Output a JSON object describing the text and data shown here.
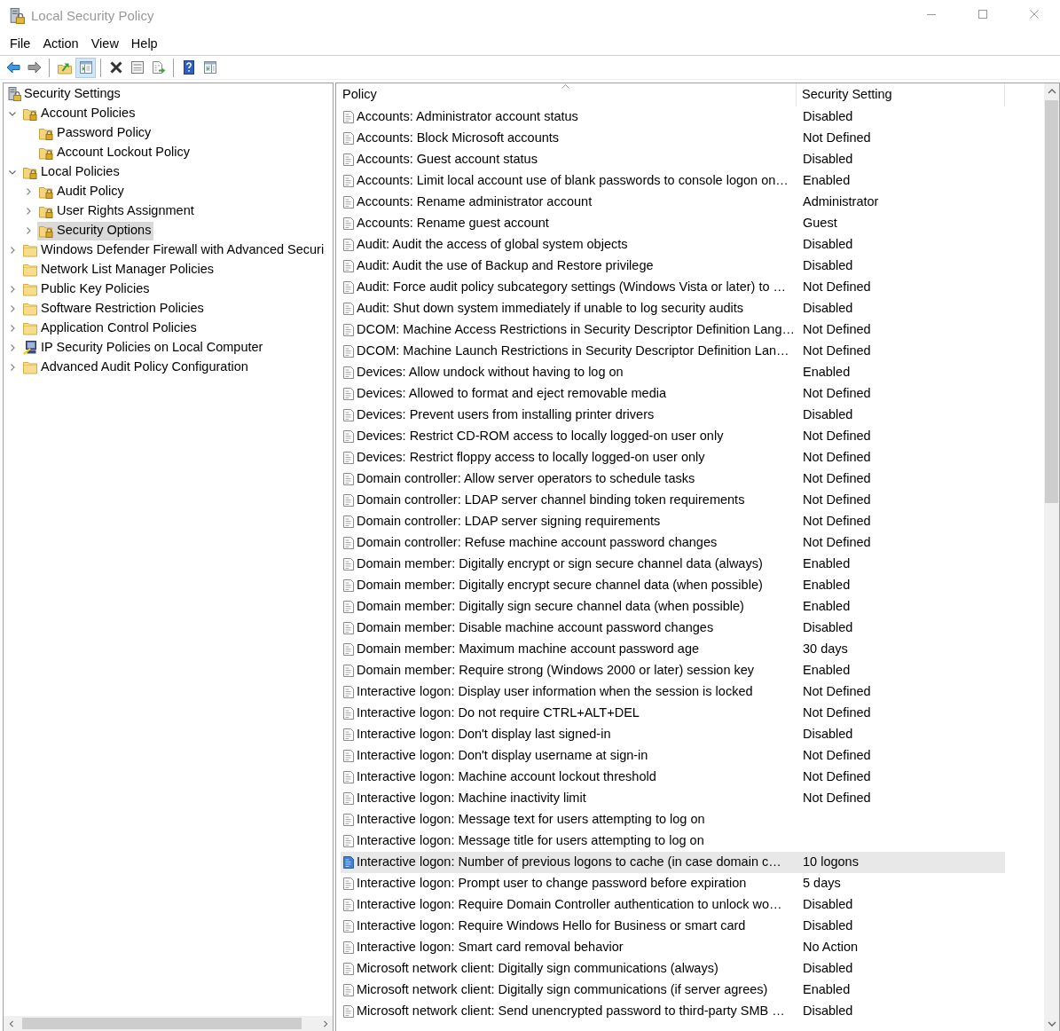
{
  "window": {
    "title": "Local Security Policy"
  },
  "menu_bar": [
    "File",
    "Action",
    "View",
    "Help"
  ],
  "toolbar": [
    {
      "kind": "back",
      "disabled": false,
      "pressed": false
    },
    {
      "kind": "forward",
      "disabled": true,
      "pressed": false
    },
    {
      "kind": "separator"
    },
    {
      "kind": "up",
      "disabled": false,
      "pressed": false
    },
    {
      "kind": "tree",
      "disabled": false,
      "pressed": true
    },
    {
      "kind": "separator"
    },
    {
      "kind": "delete",
      "disabled": false,
      "pressed": false
    },
    {
      "kind": "properties",
      "disabled": false,
      "pressed": false
    },
    {
      "kind": "export",
      "disabled": false,
      "pressed": false
    },
    {
      "kind": "separator"
    },
    {
      "kind": "help",
      "disabled": false,
      "pressed": false
    },
    {
      "kind": "action_pane",
      "disabled": false,
      "pressed": false
    }
  ],
  "tree": [
    {
      "label": "Security Settings",
      "kind": "root",
      "selected": false,
      "children": [
        {
          "label": "Account Policies",
          "kind": "secured",
          "expanded": true,
          "selected": false,
          "children": [
            {
              "label": "Password Policy",
              "kind": "secured",
              "selected": false
            },
            {
              "label": "Account Lockout Policy",
              "kind": "secured",
              "selected": false
            }
          ]
        },
        {
          "label": "Local Policies",
          "kind": "secured",
          "expanded": true,
          "selected": false,
          "children": [
            {
              "label": "Audit Policy",
              "kind": "secured",
              "expanded": false,
              "selected": false
            },
            {
              "label": "User Rights Assignment",
              "kind": "secured",
              "expanded": false,
              "selected": false
            },
            {
              "label": "Security Options",
              "kind": "secured",
              "expanded": false,
              "selected": true
            }
          ]
        },
        {
          "label": "Windows Defender Firewall with Advanced Securi",
          "kind": "folder",
          "expanded": false,
          "selected": false
        },
        {
          "label": "Network List Manager Policies",
          "kind": "folder",
          "selected": false
        },
        {
          "label": "Public Key Policies",
          "kind": "folder",
          "expanded": false,
          "selected": false
        },
        {
          "label": "Software Restriction Policies",
          "kind": "folder",
          "expanded": false,
          "selected": false
        },
        {
          "label": "Application Control Policies",
          "kind": "folder",
          "expanded": false,
          "selected": false
        },
        {
          "label": "IP Security Policies on Local Computer",
          "kind": "ipsec",
          "expanded": false,
          "selected": false
        },
        {
          "label": "Advanced Audit Policy Configuration",
          "kind": "folder",
          "expanded": false,
          "selected": false
        }
      ]
    }
  ],
  "policy_list": {
    "columns": [
      {
        "label": "Policy",
        "sorted": true
      },
      {
        "label": "Security Setting",
        "sorted": false
      }
    ],
    "rows": [
      {
        "policy": "Accounts: Administrator account status",
        "setting": "Disabled",
        "selected": false
      },
      {
        "policy": "Accounts: Block Microsoft accounts",
        "setting": "Not Defined",
        "selected": false
      },
      {
        "policy": "Accounts: Guest account status",
        "setting": "Disabled",
        "selected": false
      },
      {
        "policy": "Accounts: Limit local account use of blank passwords to console logon on…",
        "setting": "Enabled",
        "selected": false
      },
      {
        "policy": "Accounts: Rename administrator account",
        "setting": "Administrator",
        "selected": false
      },
      {
        "policy": "Accounts: Rename guest account",
        "setting": "Guest",
        "selected": false
      },
      {
        "policy": "Audit: Audit the access of global system objects",
        "setting": "Disabled",
        "selected": false
      },
      {
        "policy": "Audit: Audit the use of Backup and Restore privilege",
        "setting": "Disabled",
        "selected": false
      },
      {
        "policy": "Audit: Force audit policy subcategory settings (Windows Vista or later) to …",
        "setting": "Not Defined",
        "selected": false
      },
      {
        "policy": "Audit: Shut down system immediately if unable to log security audits",
        "setting": "Disabled",
        "selected": false
      },
      {
        "policy": "DCOM: Machine Access Restrictions in Security Descriptor Definition Lang…",
        "setting": "Not Defined",
        "selected": false
      },
      {
        "policy": "DCOM: Machine Launch Restrictions in Security Descriptor Definition Lan…",
        "setting": "Not Defined",
        "selected": false
      },
      {
        "policy": "Devices: Allow undock without having to log on",
        "setting": "Enabled",
        "selected": false
      },
      {
        "policy": "Devices: Allowed to format and eject removable media",
        "setting": "Not Defined",
        "selected": false
      },
      {
        "policy": "Devices: Prevent users from installing printer drivers",
        "setting": "Disabled",
        "selected": false
      },
      {
        "policy": "Devices: Restrict CD-ROM access to locally logged-on user only",
        "setting": "Not Defined",
        "selected": false
      },
      {
        "policy": "Devices: Restrict floppy access to locally logged-on user only",
        "setting": "Not Defined",
        "selected": false
      },
      {
        "policy": "Domain controller: Allow server operators to schedule tasks",
        "setting": "Not Defined",
        "selected": false
      },
      {
        "policy": "Domain controller: LDAP server channel binding token requirements",
        "setting": "Not Defined",
        "selected": false
      },
      {
        "policy": "Domain controller: LDAP server signing requirements",
        "setting": "Not Defined",
        "selected": false
      },
      {
        "policy": "Domain controller: Refuse machine account password changes",
        "setting": "Not Defined",
        "selected": false
      },
      {
        "policy": "Domain member: Digitally encrypt or sign secure channel data (always)",
        "setting": "Enabled",
        "selected": false
      },
      {
        "policy": "Domain member: Digitally encrypt secure channel data (when possible)",
        "setting": "Enabled",
        "selected": false
      },
      {
        "policy": "Domain member: Digitally sign secure channel data (when possible)",
        "setting": "Enabled",
        "selected": false
      },
      {
        "policy": "Domain member: Disable machine account password changes",
        "setting": "Disabled",
        "selected": false
      },
      {
        "policy": "Domain member: Maximum machine account password age",
        "setting": "30 days",
        "selected": false
      },
      {
        "policy": "Domain member: Require strong (Windows 2000 or later) session key",
        "setting": "Enabled",
        "selected": false
      },
      {
        "policy": "Interactive logon: Display user information when the session is locked",
        "setting": "Not Defined",
        "selected": false
      },
      {
        "policy": "Interactive logon: Do not require CTRL+ALT+DEL",
        "setting": "Not Defined",
        "selected": false
      },
      {
        "policy": "Interactive logon: Don't display last signed-in",
        "setting": "Disabled",
        "selected": false
      },
      {
        "policy": "Interactive logon: Don't display username at sign-in",
        "setting": "Not Defined",
        "selected": false
      },
      {
        "policy": "Interactive logon: Machine account lockout threshold",
        "setting": "Not Defined",
        "selected": false
      },
      {
        "policy": "Interactive logon: Machine inactivity limit",
        "setting": "Not Defined",
        "selected": false
      },
      {
        "policy": "Interactive logon: Message text for users attempting to log on",
        "selected": false
      },
      {
        "policy": "Interactive logon: Message title for users attempting to log on",
        "selected": false
      },
      {
        "policy": "Interactive logon: Number of previous logons to cache (in case domain c…",
        "setting": "10 logons",
        "selected": true
      },
      {
        "policy": "Interactive logon: Prompt user to change password before expiration",
        "setting": "5 days",
        "selected": false
      },
      {
        "policy": "Interactive logon: Require Domain Controller authentication to unlock wo…",
        "setting": "Disabled",
        "selected": false
      },
      {
        "policy": "Interactive logon: Require Windows Hello for Business or smart card",
        "setting": "Disabled",
        "selected": false
      },
      {
        "policy": "Interactive logon: Smart card removal behavior",
        "setting": "No Action",
        "selected": false
      },
      {
        "policy": "Microsoft network client: Digitally sign communications (always)",
        "setting": "Disabled",
        "selected": false
      },
      {
        "policy": "Microsoft network client: Digitally sign communications (if server agrees)",
        "setting": "Enabled",
        "selected": false
      },
      {
        "policy": "Microsoft network client: Send unencrypted password to third-party SMB …",
        "setting": "Disabled",
        "selected": false
      }
    ]
  }
}
